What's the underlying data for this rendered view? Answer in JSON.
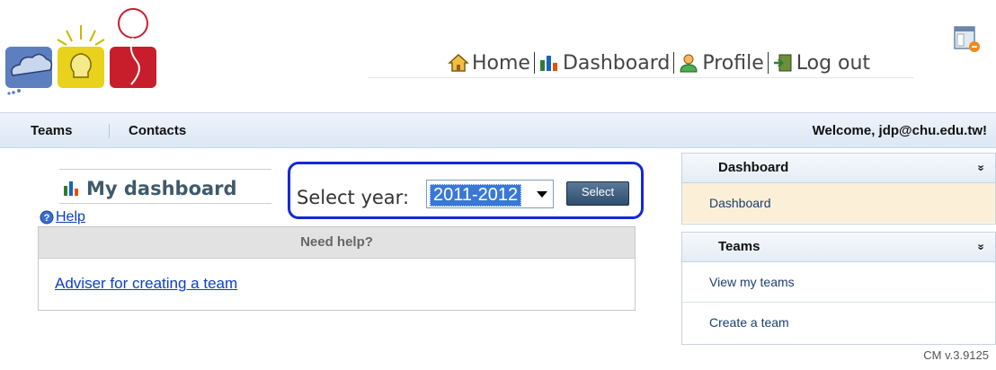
{
  "topnav": {
    "items": [
      {
        "label": "Home",
        "icon": "home-icon"
      },
      {
        "label": "Dashboard",
        "icon": "bar-chart-icon"
      },
      {
        "label": "Profile",
        "icon": "user-icon"
      },
      {
        "label": "Log out",
        "icon": "logout-icon"
      }
    ]
  },
  "menubar": {
    "items": [
      {
        "label": "Teams"
      },
      {
        "label": "Contacts"
      }
    ],
    "welcome": "Welcome, jdp@chu.edu.tw!"
  },
  "main": {
    "title": "My dashboard",
    "help_label": "Help",
    "year_label": "Select year:",
    "year_value": "2011-2012",
    "select_button": "Select",
    "help_panel": {
      "header": "Need help?",
      "link": "Adviser for creating a team"
    }
  },
  "sidebar": {
    "dashboard": {
      "title": "Dashboard",
      "chevron": "»",
      "items": [
        {
          "label": "Dashboard"
        }
      ]
    },
    "teams": {
      "title": "Teams",
      "chevron": "»",
      "items": [
        {
          "label": "View my teams"
        },
        {
          "label": "Create a team"
        }
      ]
    }
  },
  "footer": {
    "version": "CM v.3.9125"
  },
  "colors": {
    "accent": "#1428d8",
    "link": "#0b3fc2",
    "menubar": "#dbe7f4",
    "active_row": "#fbefd8"
  }
}
